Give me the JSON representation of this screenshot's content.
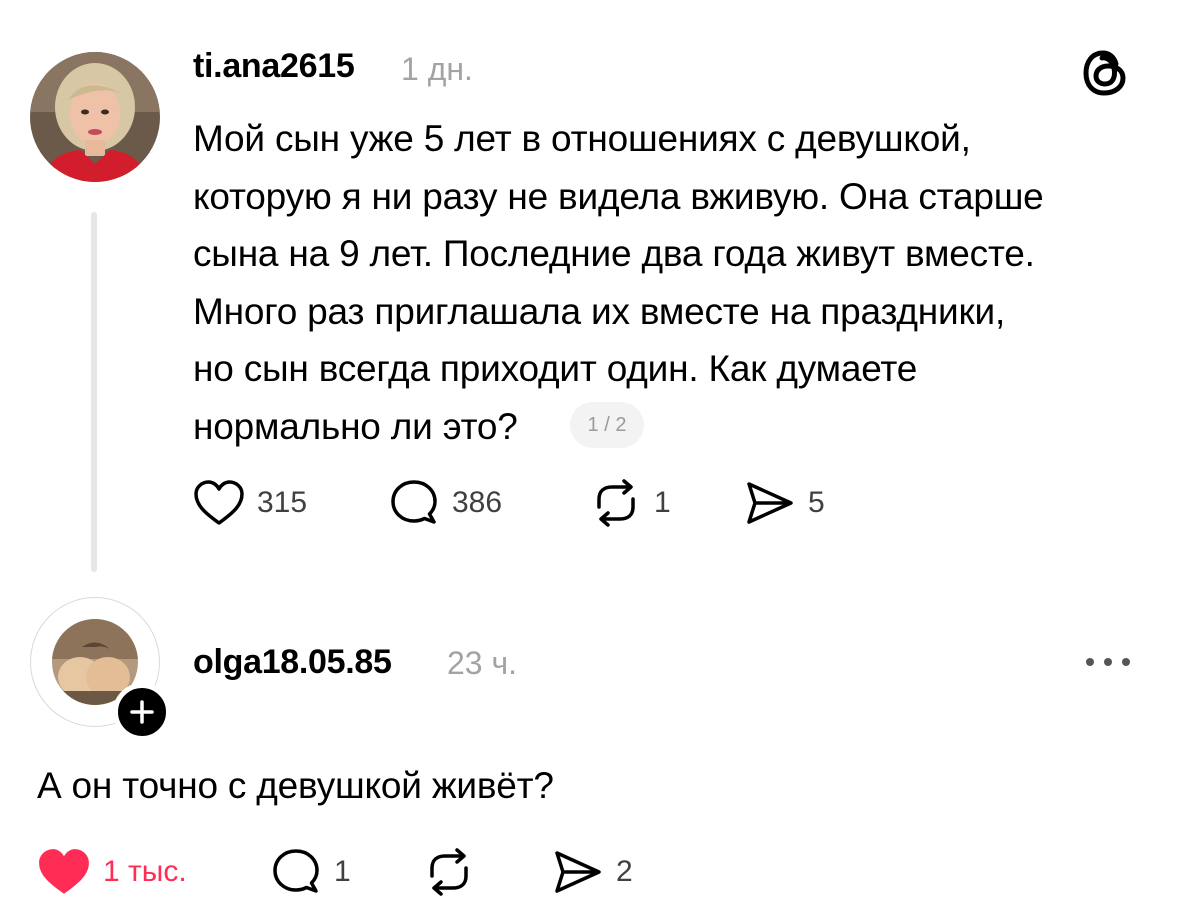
{
  "post": {
    "username": "ti.ana2615",
    "time": "1 дн.",
    "text_lines": [
      "Мой сын уже 5 лет в отношениях с девушкой,",
      "которую я ни разу не видела вживую. Она старше",
      "сына на 9 лет. Последние два года живут вместе.",
      "Много раз приглашала их вместе на праздники,",
      "но сын всегда приходит один. Как думаете",
      "нормально ли это?"
    ],
    "page_indicator": "1 / 2",
    "actions": {
      "likes": "315",
      "comments": "386",
      "reposts": "1",
      "shares": "5"
    },
    "icons": {
      "app_logo": "threads-logo-icon",
      "like": "heart-outline-icon",
      "comment": "speech-bubble-icon",
      "repost": "repost-arrows-icon",
      "share": "paper-plane-icon"
    }
  },
  "reply": {
    "username": "olga18.05.85",
    "time": "23 ч.",
    "text": "А он точно с девушкой живёт?",
    "actions": {
      "likes": "1 тыс.",
      "comments": "1",
      "shares": "2"
    },
    "icons": {
      "follow": "plus-icon",
      "more": "more-dots-icon",
      "like": "heart-filled-icon",
      "comment": "speech-bubble-icon",
      "repost": "repost-arrows-icon",
      "share": "paper-plane-icon"
    },
    "liked": true
  },
  "colors": {
    "text": "#000000",
    "secondary_text": "#a3a3a3",
    "count_text": "#404040",
    "liked": "#ff2d55",
    "thread_line": "#e6e6e6",
    "badge_bg": "#f3f3f3"
  }
}
